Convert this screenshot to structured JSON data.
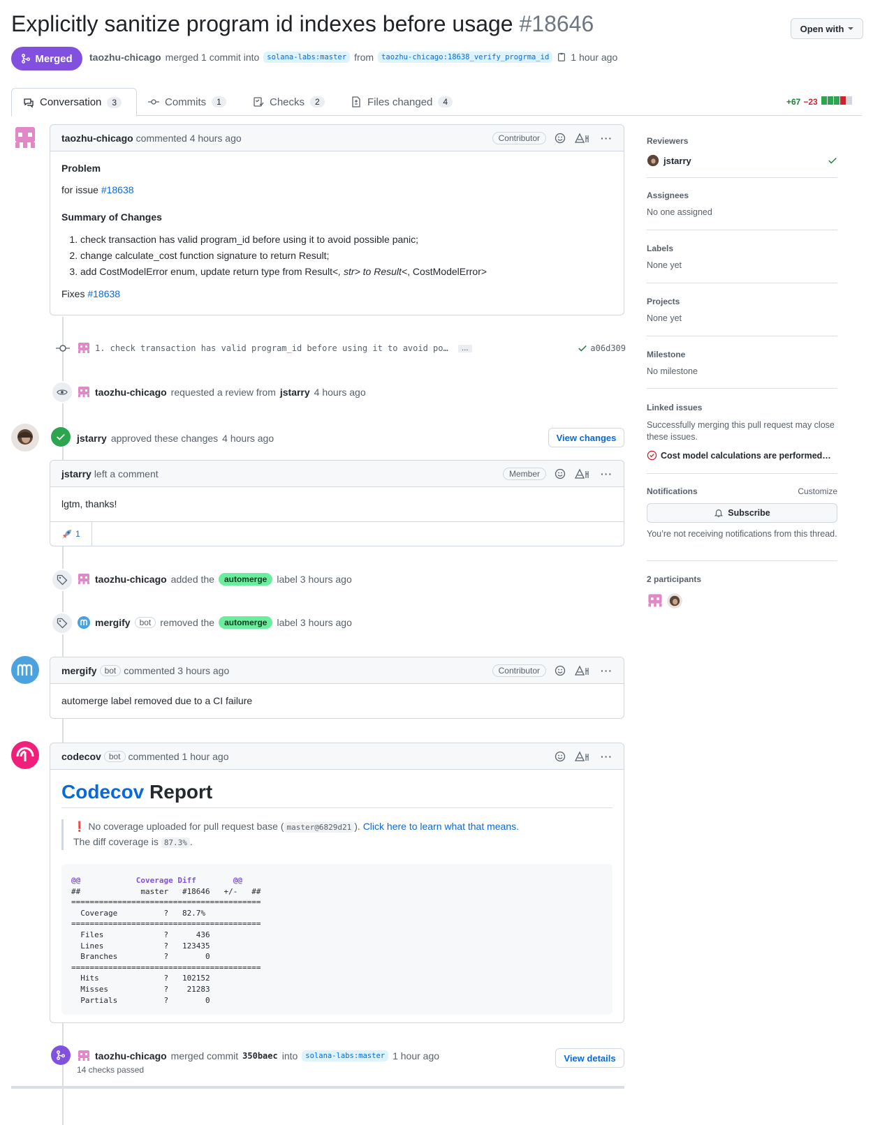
{
  "header": {
    "title": "Explicitly sanitize program id indexes before usage",
    "number": "#18646",
    "open_with": "Open with",
    "state": "Merged",
    "author": "taozhu-chicago",
    "merged_text": "merged 1 commit into",
    "base_branch": "solana-labs:master",
    "from": "from",
    "head_branch": "taozhu-chicago:18638_verify_progrma_id",
    "time": "1 hour ago"
  },
  "tabs": [
    {
      "label": "Conversation",
      "count": "3"
    },
    {
      "label": "Commits",
      "count": "1"
    },
    {
      "label": "Checks",
      "count": "2"
    },
    {
      "label": "Files changed",
      "count": "4"
    }
  ],
  "diffstat": {
    "additions": "+67",
    "deletions": "−23"
  },
  "comment1": {
    "author": "taozhu-chicago",
    "action": "commented 4 hours ago",
    "role": "Contributor",
    "problem_heading": "Problem",
    "issue_prefix": "for issue",
    "issue_link": "#18638",
    "summary_heading": "Summary of Changes",
    "items": [
      "check transaction has valid program_id before using it to avoid possible panic;",
      "change calculate_cost function signature to return Result;"
    ],
    "item3_a": "add CostModelError enum, update return type from Result<",
    "item3_b": ", str> to Result<",
    "item3_c": ", CostModelError>",
    "fixes_prefix": "Fixes",
    "fixes_link": "#18638"
  },
  "commit": {
    "message": "1. check transaction has valid program_id before using it to avoid po…",
    "ellipsis": "…",
    "sha": "a06d309"
  },
  "review_request": {
    "author": "taozhu-chicago",
    "text": "requested a review from",
    "reviewer": "jstarry",
    "time": "4 hours ago"
  },
  "approval": {
    "author": "jstarry",
    "text": "approved these changes",
    "time": "4 hours ago",
    "button": "View changes"
  },
  "comment2": {
    "author": "jstarry",
    "action": "left a comment",
    "role": "Member",
    "body": "lgtm, thanks!",
    "reaction_count": "1"
  },
  "label_added": {
    "author": "taozhu-chicago",
    "text": "added the",
    "label": "automerge",
    "suffix": "label 3 hours ago"
  },
  "label_removed": {
    "author": "mergify",
    "bot": "bot",
    "text": "removed the",
    "label": "automerge",
    "suffix": "label 3 hours ago"
  },
  "comment3": {
    "author": "mergify",
    "bot": "bot",
    "action": "commented 3 hours ago",
    "role": "Contributor",
    "body": "automerge label removed due to a CI failure"
  },
  "comment4": {
    "author": "codecov",
    "bot": "bot",
    "action": "commented 1 hour ago",
    "title_link": "Codecov",
    "title_rest": "Report",
    "warn_a": "No coverage uploaded for pull request base (",
    "warn_code": "master@6829d21",
    "warn_b": ").",
    "warn_link": "Click here to learn what that means.",
    "diff_a": "The diff coverage is",
    "diff_code": "87.3%",
    "diff_b": ".",
    "table_l1_a": "@@",
    "table_l1_b": "Coverage Diff",
    "table_l1_c": "@@",
    "table_rest": "##             master   #18646   +/-   ##\n=========================================\n  Coverage          ?   82.7%           \n=========================================\n  Files             ?      436           \n  Lines             ?   123435           \n  Branches          ?        0           \n=========================================\n  Hits              ?   102152           \n  Misses            ?    21283           \n  Partials          ?        0           "
  },
  "merge_event": {
    "author": "taozhu-chicago",
    "text": "merged commit",
    "sha": "350baec",
    "into": "into",
    "branch": "solana-labs:master",
    "time": "1 hour ago",
    "checks": "14 checks passed",
    "button": "View details"
  },
  "sidebar": {
    "reviewers_h": "Reviewers",
    "reviewer": "jstarry",
    "assignees_h": "Assignees",
    "assignees_v": "No one assigned",
    "labels_h": "Labels",
    "labels_v": "None yet",
    "projects_h": "Projects",
    "projects_v": "None yet",
    "milestone_h": "Milestone",
    "milestone_v": "No milestone",
    "linked_h": "Linked issues",
    "linked_v": "Successfully merging this pull request may close these issues.",
    "linked_issue": "Cost model calculations are performed…",
    "notifications_h": "Notifications",
    "customize": "Customize",
    "subscribe": "Subscribe",
    "notif_v": "You’re not receiving notifications from this thread.",
    "participants_h": "2 participants"
  },
  "colors": {
    "merged": "#8250df",
    "link": "#0969da",
    "automerge": "#6aee9e"
  }
}
